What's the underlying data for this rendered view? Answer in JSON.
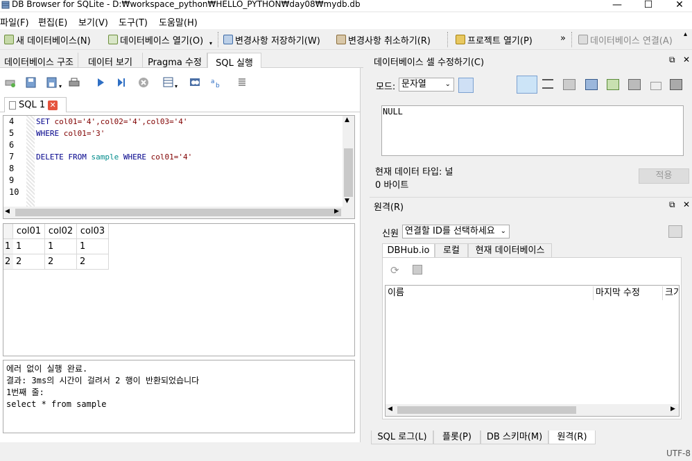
{
  "window": {
    "title": "DB Browser for SQLite - D:₩workspace_python₩HELLO_PYTHON₩day08₩mydb.db",
    "minimize": "—",
    "maximize": "☐",
    "close": "✕"
  },
  "menu": [
    "파일(F)",
    "편집(E)",
    "보기(V)",
    "도구(T)",
    "도움말(H)"
  ],
  "toolbar": {
    "new_db": "새 데이터베이스(N)",
    "open_db": "데이터베이스 열기(O)",
    "write_changes": "변경사항 저장하기(W)",
    "revert_changes": "변경사항 취소하기(R)",
    "open_project": "프로젝트 열기(P)",
    "more": "»",
    "attach_db": "데이터베이스 연결(A)"
  },
  "main_tabs": [
    "데이터베이스 구조",
    "데이터 보기",
    "Pragma 수정",
    "SQL 실행"
  ],
  "editor": {
    "tab_label": "SQL 1",
    "line_numbers": [
      "4",
      "5",
      "6",
      "7",
      "8",
      "9",
      "10"
    ],
    "lines": [
      {
        "kw1": "SET ",
        "rest": "col01='4',col02='4',col03='4'"
      },
      {
        "kw1": "WHERE ",
        "rest": "col01='3'"
      },
      {
        "kw1": "",
        "rest": ""
      },
      {
        "kw1": "DELETE FROM ",
        "table": "sample",
        "kw2": " WHERE ",
        "col": "col01",
        "str": "='4'"
      },
      {
        "kw1": "",
        "rest": ""
      },
      {
        "kw1": "",
        "rest": ""
      },
      {
        "kw1": "",
        "rest": ""
      }
    ]
  },
  "results": {
    "columns": [
      "col01",
      "col02",
      "col03"
    ],
    "rows": [
      {
        "row_no": "1",
        "cells": [
          "1",
          "1",
          "1"
        ]
      },
      {
        "row_no": "2",
        "cells": [
          "2",
          "2",
          "2"
        ]
      }
    ]
  },
  "messages": [
    "에러 없이 실행 완료.",
    "결과: 3ms의 시간이 걸려서 2 행이 반환되었습니다",
    "1번째 줄:",
    "select * from sample"
  ],
  "cell_edit": {
    "title": "데이터베이스 셀 수정하기(C)",
    "mode_label": "모드:",
    "mode_value": "문자열",
    "value": "NULL",
    "type_text": "현재 데이터 타입: 널",
    "size_text": "0 바이트",
    "apply": "적용"
  },
  "remote": {
    "title": "원격(R)",
    "identity_label": "신원",
    "identity_value": "연결할 ID를 선택하세요",
    "tabs": [
      "DBHub.io",
      "로컬",
      "현재 데이터베이스"
    ],
    "columns": [
      "이름",
      "마지막 수정",
      "크기"
    ]
  },
  "dock_controls": {
    "float": "⧉",
    "close": "✕"
  },
  "bottom_tabs": [
    "SQL 로그(L)",
    "플롯(P)",
    "DB 스키마(M)",
    "원격(R)"
  ],
  "status": {
    "encoding": "UTF-8"
  },
  "colors": {
    "keyword": "#00008b",
    "string": "#008000",
    "table": "#008b8b",
    "column": "#800000",
    "close_tab": "#e5543e"
  }
}
